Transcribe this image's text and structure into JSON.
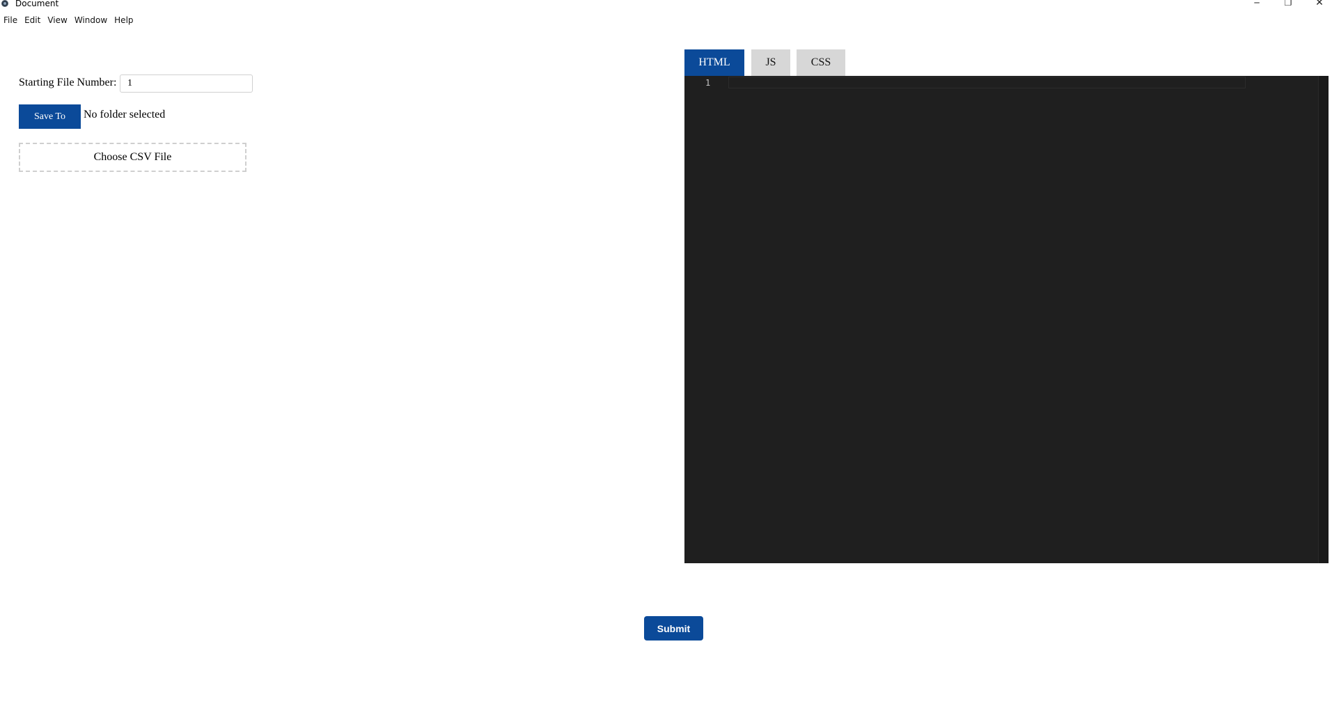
{
  "window": {
    "title": "Document",
    "controls": {
      "minimize": "─",
      "maximize": "❐",
      "close": "✕"
    }
  },
  "menu": [
    {
      "label": "File"
    },
    {
      "label": "Edit"
    },
    {
      "label": "View"
    },
    {
      "label": "Window"
    },
    {
      "label": "Help"
    }
  ],
  "form": {
    "start_label": "Starting File Number:",
    "start_value": "1",
    "save_button": "Save To",
    "folder_status": "No folder selected",
    "choose_csv": "Choose CSV File"
  },
  "editor": {
    "tabs": [
      {
        "label": "HTML",
        "active": true
      },
      {
        "label": "JS",
        "active": false
      },
      {
        "label": "CSS",
        "active": false
      }
    ],
    "line_number": "1",
    "content": ""
  },
  "submit_label": "Submit",
  "colors": {
    "accent": "#0b4a99",
    "editor_bg": "#1f1f1f",
    "tab_inactive": "#d7d7d7"
  }
}
